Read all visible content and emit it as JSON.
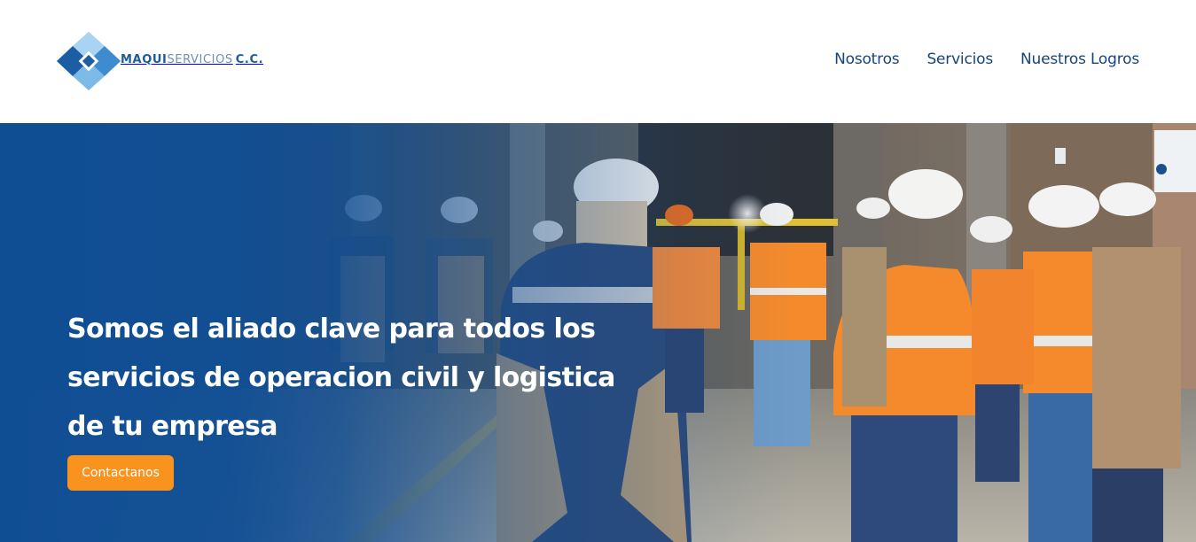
{
  "brand": {
    "name_part1": "MAQUI",
    "name_part2": "SERVICIOS",
    "name_part3": "C.C.",
    "primary_color": "#1a5c9e",
    "secondary_color": "#6f8fb0"
  },
  "nav": {
    "items": [
      {
        "label": "Nosotros"
      },
      {
        "label": "Servicios"
      },
      {
        "label": "Nuestros Logros"
      }
    ]
  },
  "hero": {
    "title": "Somos el aliado clave para todos los servicios de operacion civil y logistica de tu empresa",
    "cta_label": "Contactanos",
    "overlay_color": "#104e94",
    "cta_color": "#f7931e",
    "background_description_icon": "workers-meeting-image"
  }
}
